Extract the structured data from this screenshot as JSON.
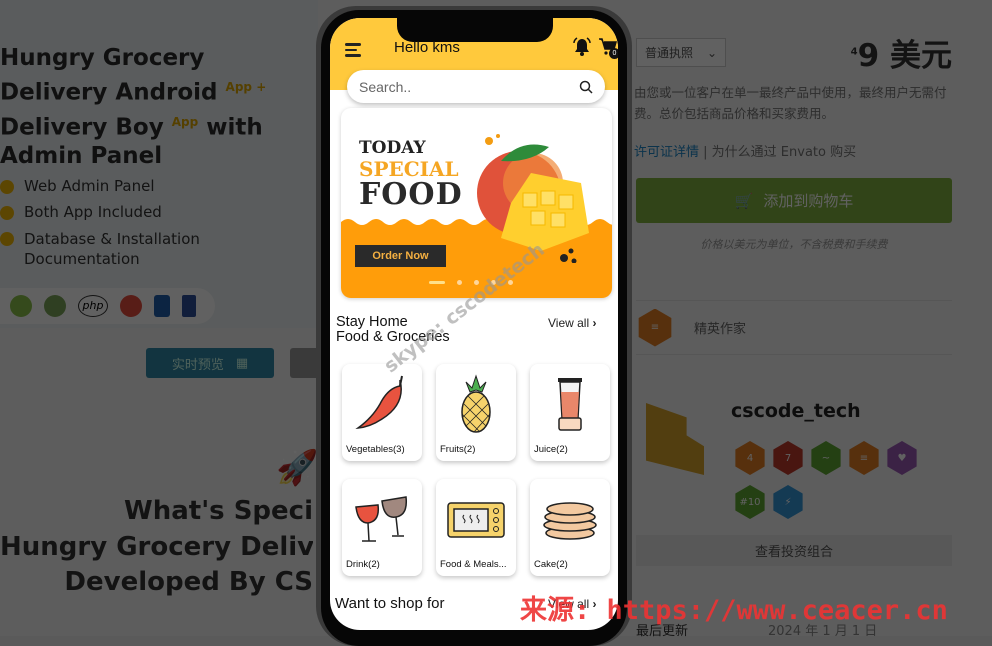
{
  "background_page": {
    "hero": {
      "title_lines": [
        "Hungry Grocery",
        "Delivery Android",
        "Delivery Boy",
        "Admin Panel"
      ],
      "sup1": "App +",
      "sup2": "App",
      "with": "with",
      "bullets": [
        "Web Admin Panel",
        "Both App Included",
        "Database & Installation\nDocumentation"
      ],
      "tech_icons": [
        "android-icon",
        "api-icon",
        "php-icon",
        "opencart-icon",
        "paypal-icon",
        "analytics-icon"
      ],
      "php": "php"
    },
    "preview_button": "实时预览",
    "whats_special": [
      "What's Speci",
      "Hungry Grocery Deliv",
      "Developed By CS"
    ],
    "license_select": "普通执照",
    "price": "9 美元",
    "price_sup": "4",
    "license_desc": "由您或一位客户在单一最终产品中使用，最终用户无需付费。总价包括商品价格和买家费用。",
    "license_link": "许可证详情",
    "why_link": "为什么通过 Envato 购买",
    "add_to_cart": "添加到购物车",
    "price_note": "价格以美元为单位，不含税费和手续费",
    "featured_author": "精英作家",
    "author_name": "cscode_tech",
    "badges": [
      {
        "text": "4",
        "color": "#e67e22"
      },
      {
        "text": "7",
        "color": "#c0392b"
      },
      {
        "text": "~",
        "color": "#5fa832"
      },
      {
        "text": "≡",
        "color": "#e67e22"
      },
      {
        "text": "♥",
        "color": "#9b59b6"
      },
      {
        "text": "#10",
        "color": "#5fa832"
      },
      {
        "text": "⚡",
        "color": "#3498db"
      }
    ],
    "portfolio_button": "查看投资组合",
    "last_updated_label": "最后更新",
    "last_updated_value": "2024 年 1 月 1 日"
  },
  "app": {
    "greeting": "Hello kms",
    "cart_count": "0",
    "search_placeholder": "Search..",
    "banner": {
      "line1": "TODAY",
      "line2": "SPECIAL",
      "line3": "FOOD",
      "cta": "Order Now",
      "slides": 5,
      "active_slide": 1
    },
    "section1_title": "Stay Home\nFood & Groceries",
    "view_all": "View all",
    "categories": [
      {
        "label": "Vegetables(3)",
        "icon": "chili-icon"
      },
      {
        "label": "Fruits(2)",
        "icon": "pineapple-icon"
      },
      {
        "label": "Juice(2)",
        "icon": "blender-icon"
      },
      {
        "label": "Drink(2)",
        "icon": "wine-glasses-icon"
      },
      {
        "label": "Food & Meals...",
        "icon": "microwave-icon"
      },
      {
        "label": "Cake(2)",
        "icon": "pancakes-icon"
      }
    ],
    "section2_title": "Want to shop for"
  },
  "watermarks": {
    "skype": "skype: cscodetech",
    "source": "来源: https://www.ceacer.cn"
  },
  "colors": {
    "header": "#ffc93c",
    "banner_orange": "#ff9d0a",
    "cart_green": "#82b440",
    "preview_teal": "#2f8aa8"
  }
}
